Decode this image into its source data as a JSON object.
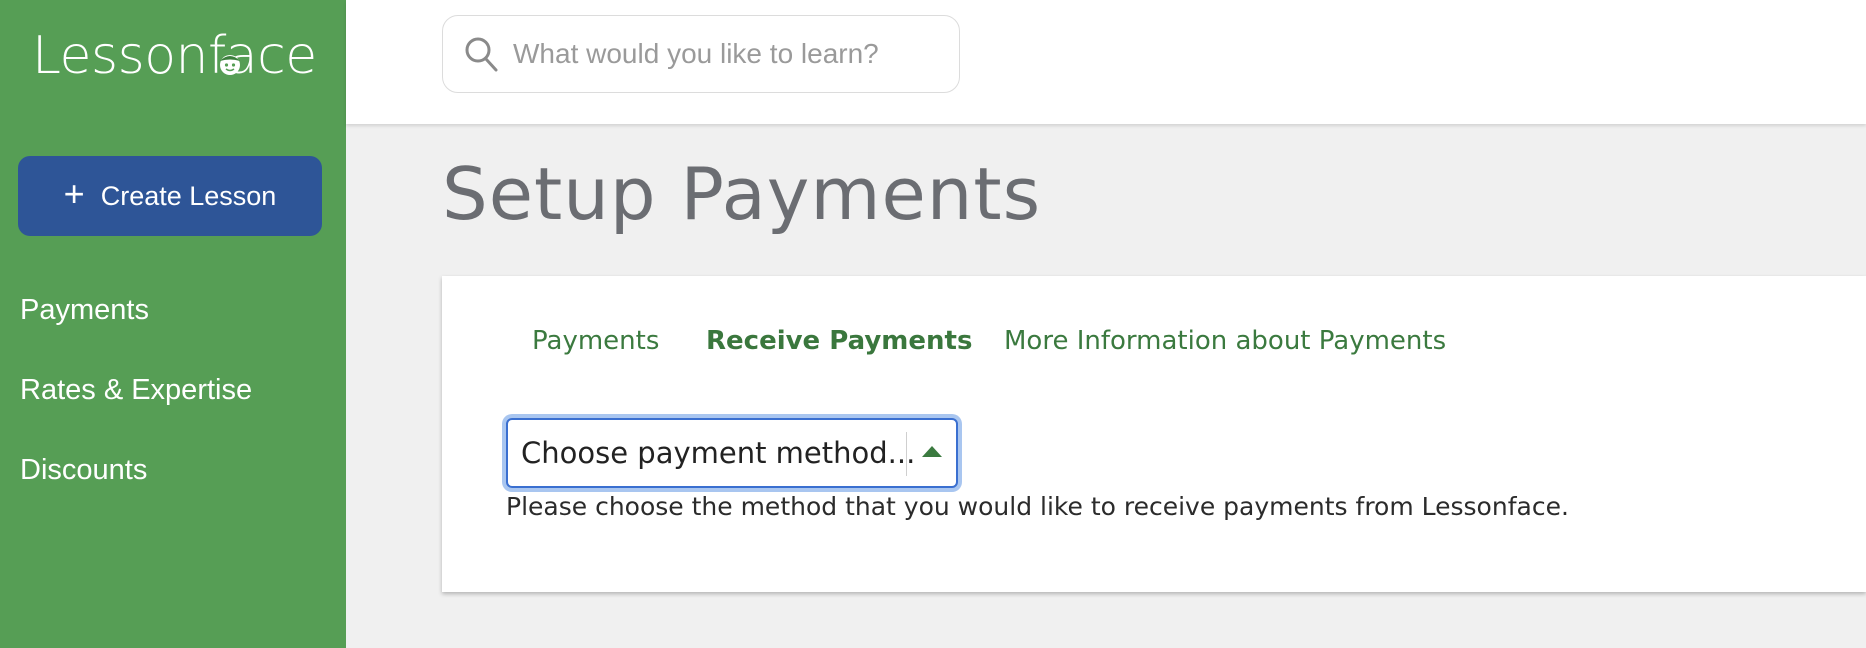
{
  "brand": {
    "name": "Lessonface"
  },
  "sidebar": {
    "create_label": "Create Lesson",
    "items": [
      {
        "label": "Payments"
      },
      {
        "label": "Rates & Expertise"
      },
      {
        "label": "Discounts"
      }
    ]
  },
  "search": {
    "placeholder": "What would you like to learn?"
  },
  "page": {
    "title": "Setup Payments"
  },
  "tabs": [
    {
      "label": "Payments",
      "active": false
    },
    {
      "label": "Receive Payments",
      "active": true
    },
    {
      "label": "More Information about Payments",
      "active": false
    }
  ],
  "payment_select": {
    "value": "Choose payment method...",
    "help": "Please choose the method that you would like to receive payments from Lessonface."
  },
  "colors": {
    "sidebar": "#569e55",
    "create_button": "#2e5597",
    "tab_text": "#3b7a3f",
    "title": "#6b6d72"
  }
}
